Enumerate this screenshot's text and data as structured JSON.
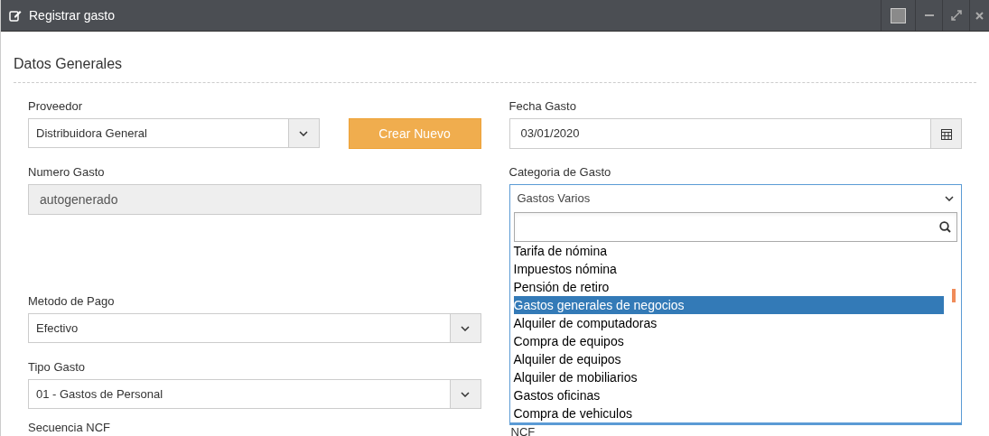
{
  "window": {
    "title": "Registrar gasto"
  },
  "section_title": "Datos Generales",
  "proveedor": {
    "label": "Proveedor",
    "value": "Distribuidora General"
  },
  "create_button": "Crear Nuevo",
  "numero_gasto": {
    "label": "Numero Gasto",
    "value": "autogenerado",
    "disabled": true
  },
  "metodo_pago": {
    "label": "Metodo de Pago",
    "value": "Efectivo"
  },
  "tipo_gasto": {
    "label": "Tipo Gasto",
    "value": "01 - Gastos de Personal"
  },
  "secuencia_label": "Secuencia NCF",
  "fecha_gasto": {
    "label": "Fecha Gasto",
    "value": "03/01/2020"
  },
  "categoria": {
    "label": "Categoria de Gasto",
    "value": "Gastos Varios",
    "expanded": true,
    "options": [
      {
        "label": "Tarifa de nómina",
        "selected": false
      },
      {
        "label": "Impuestos nómina",
        "selected": false
      },
      {
        "label": "Pensión de retiro",
        "selected": false
      },
      {
        "label": "Gastos generales de negocios",
        "selected": true
      },
      {
        "label": "Alquiler de computadoras",
        "selected": false
      },
      {
        "label": "Compra de equipos",
        "selected": false
      },
      {
        "label": "Alquiler de equipos",
        "selected": false
      },
      {
        "label": "Alquiler de mobiliarios",
        "selected": false
      },
      {
        "label": "Gastos oficinas",
        "selected": false
      },
      {
        "label": "Compra de vehiculos",
        "selected": false
      }
    ]
  },
  "ncf_label": "NCF"
}
